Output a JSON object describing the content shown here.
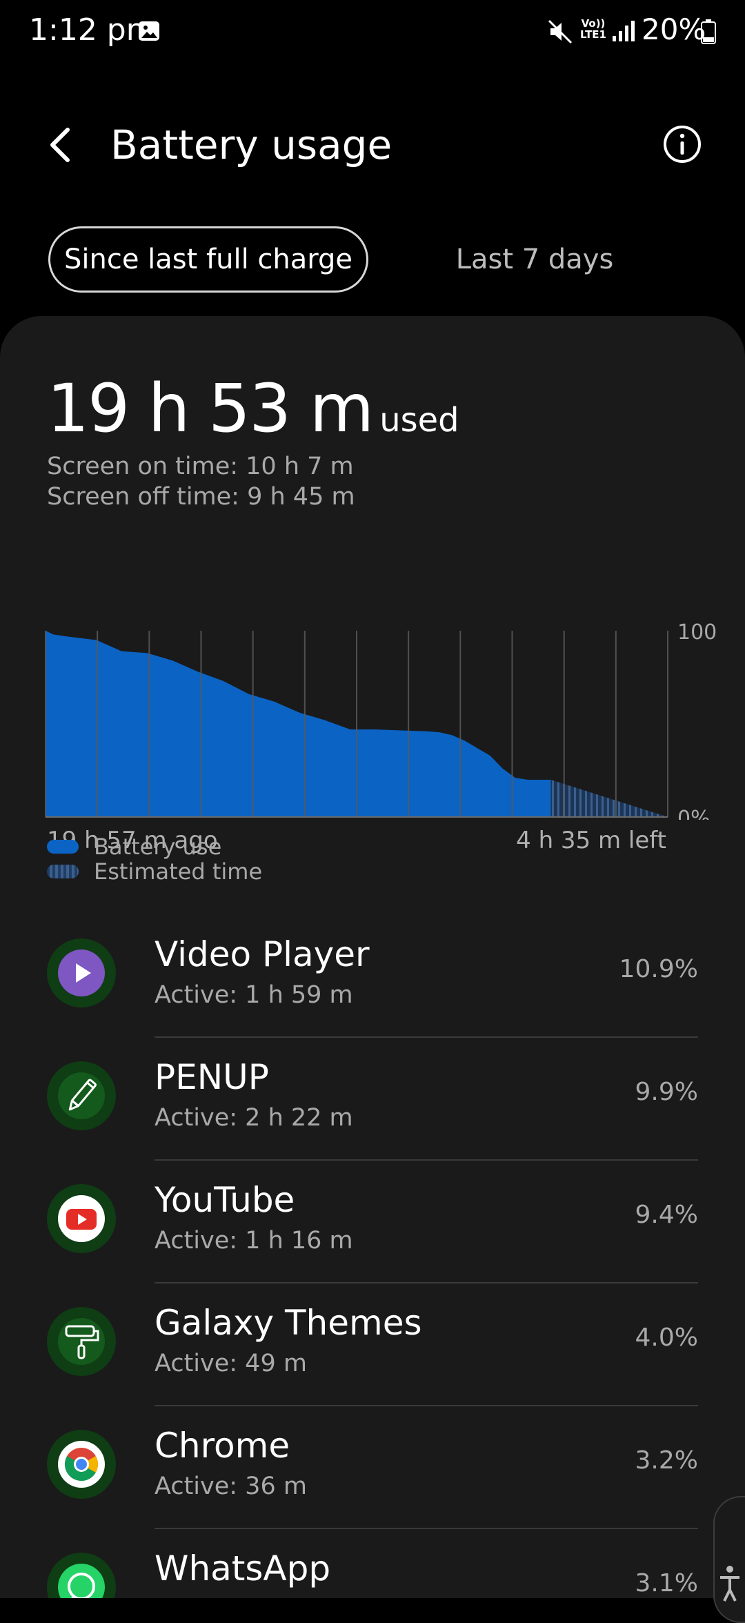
{
  "status_bar": {
    "time": "1:12 pm",
    "network_label": "Vo)) LTE1",
    "battery_percent": "20%"
  },
  "header": {
    "title": "Battery usage"
  },
  "tabs": [
    {
      "label": "Since last full charge",
      "selected": true
    },
    {
      "label": "Last 7 days",
      "selected": false
    }
  ],
  "summary": {
    "used_value": "19 h 53 m",
    "used_suffix": "used",
    "screen_on": "Screen on time: 10 h 7 m",
    "screen_off": "Screen off time: 9 h 45 m"
  },
  "chart_data": {
    "type": "area",
    "x_start_label": "19 h 57 m ago",
    "x_end_label": "4 h 35 m left",
    "y_tick_labels": [
      "100",
      "0%"
    ],
    "ylim": [
      0,
      100
    ],
    "grid": true,
    "series": [
      {
        "name": "Battery use",
        "color": "#0b63c4",
        "x": [
          0,
          0.3,
          0.8,
          2,
          3,
          4,
          5,
          6,
          7,
          8,
          9,
          10,
          11,
          12,
          13,
          14,
          15,
          15.5,
          16,
          16.5,
          17,
          17.5,
          18,
          18.5,
          19,
          19.5,
          19.9
        ],
        "y": [
          100,
          98,
          97,
          95,
          89,
          88,
          84,
          78,
          73,
          66,
          62,
          56,
          52,
          47,
          47,
          46.5,
          46,
          45.5,
          44,
          41,
          37,
          33,
          26,
          21,
          20,
          20,
          20
        ]
      },
      {
        "name": "Estimated time",
        "color": "#3c5f8b",
        "x": [
          19.9,
          24.5
        ],
        "y": [
          20,
          0
        ]
      }
    ],
    "x_total_hours": 24.5
  },
  "legend": [
    {
      "label": "Battery use",
      "style": "solid"
    },
    {
      "label": "Estimated time",
      "style": "striped"
    }
  ],
  "apps": [
    {
      "name": "Video Player",
      "active": "Active: 1 h 59 m",
      "percent": "10.9%",
      "icon": "video-player-icon"
    },
    {
      "name": "PENUP",
      "active": "Active: 2 h 22 m",
      "percent": "9.9%",
      "icon": "penup-pencil-icon"
    },
    {
      "name": "YouTube",
      "active": "Active: 1 h 16 m",
      "percent": "9.4%",
      "icon": "youtube-icon"
    },
    {
      "name": "Galaxy Themes",
      "active": "Active: 49 m",
      "percent": "4.0%",
      "icon": "paint-roller-icon"
    },
    {
      "name": "Chrome",
      "active": "Active: 36 m",
      "percent": "3.2%",
      "icon": "chrome-icon"
    },
    {
      "name": "WhatsApp",
      "active": "",
      "percent": "3.1%",
      "icon": "whatsapp-icon"
    }
  ]
}
